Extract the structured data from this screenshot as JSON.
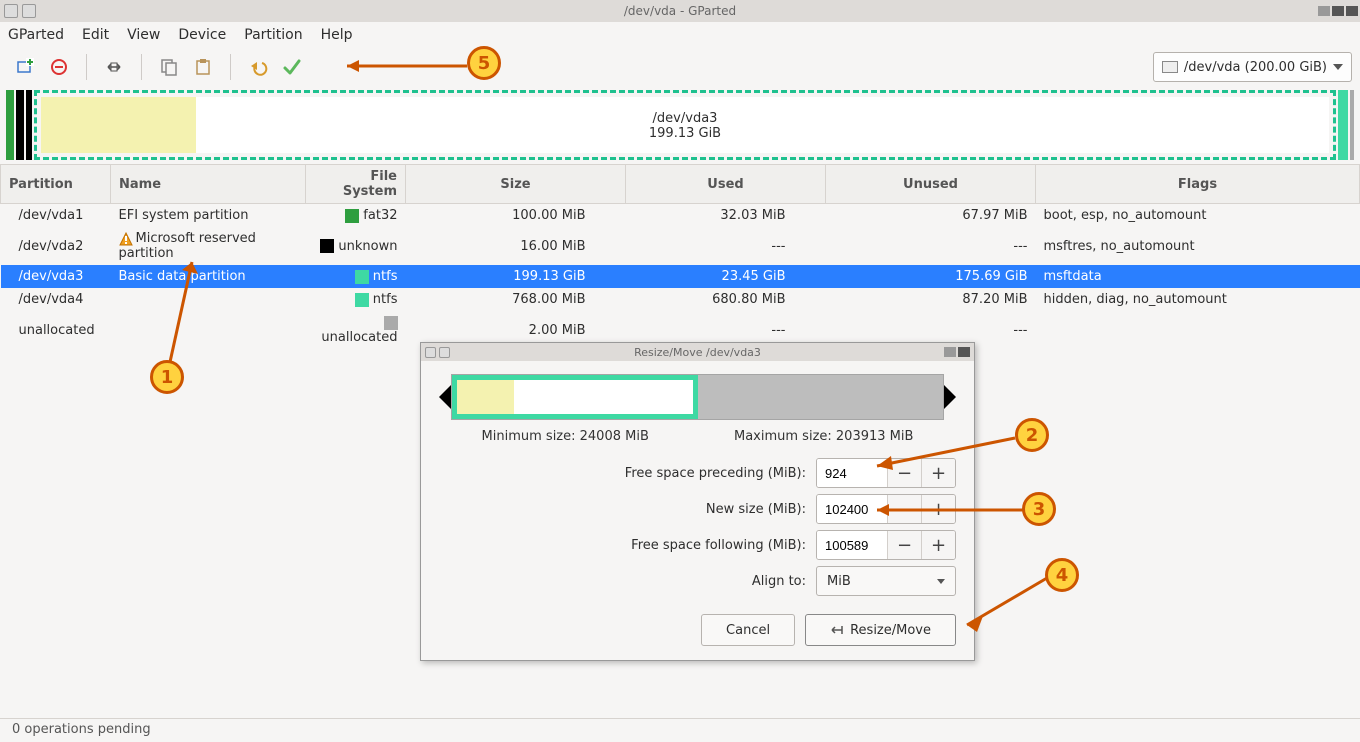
{
  "window": {
    "title": "/dev/vda - GParted"
  },
  "menu": {
    "gparted": "GParted",
    "edit": "Edit",
    "view": "View",
    "device": "Device",
    "partition": "Partition",
    "help": "Help"
  },
  "toolbar": {
    "device_label": "/dev/vda (200.00 GiB)"
  },
  "diskmap": {
    "selected_label": "/dev/vda3",
    "selected_size": "199.13 GiB"
  },
  "columns": {
    "partition": "Partition",
    "name": "Name",
    "fs": "File System",
    "size": "Size",
    "used": "Used",
    "unused": "Unused",
    "flags": "Flags"
  },
  "rows": [
    {
      "part": "/dev/vda1",
      "warn": false,
      "name": "EFI system partition",
      "fs": "fat32",
      "fscolor": "#2e9e3f",
      "size": "100.00 MiB",
      "used": "32.03 MiB",
      "unused": "67.97 MiB",
      "flags": "boot, esp, no_automount",
      "sel": false
    },
    {
      "part": "/dev/vda2",
      "warn": true,
      "name": "Microsoft reserved partition",
      "fs": "unknown",
      "fscolor": "#000",
      "size": "16.00 MiB",
      "used": "---",
      "unused": "---",
      "flags": "msftres, no_automount",
      "sel": false
    },
    {
      "part": "/dev/vda3",
      "warn": false,
      "name": "Basic data partition",
      "fs": "ntfs",
      "fscolor": "#3ed9a3",
      "size": "199.13 GiB",
      "used": "23.45 GiB",
      "unused": "175.69 GiB",
      "flags": "msftdata",
      "sel": true
    },
    {
      "part": "/dev/vda4",
      "warn": false,
      "name": "",
      "fs": "ntfs",
      "fscolor": "#3ed9a3",
      "size": "768.00 MiB",
      "used": "680.80 MiB",
      "unused": "87.20 MiB",
      "flags": "hidden, diag, no_automount",
      "sel": false
    },
    {
      "part": "unallocated",
      "warn": false,
      "name": "",
      "fs": "unallocated",
      "fscolor": "#aaa",
      "size": "2.00 MiB",
      "used": "---",
      "unused": "---",
      "flags": "",
      "sel": false
    }
  ],
  "dialog": {
    "title": "Resize/Move /dev/vda3",
    "min": "Minimum size: 24008 MiB",
    "max": "Maximum size: 203913 MiB",
    "preceding_label": "Free space preceding (MiB):",
    "preceding_value": "924",
    "newsize_label": "New size (MiB):",
    "newsize_value": "102400",
    "following_label": "Free space following (MiB):",
    "following_value": "100589",
    "align_label": "Align to:",
    "align_value": "MiB",
    "cancel": "Cancel",
    "resize": "Resize/Move"
  },
  "status": {
    "text": "0 operations pending"
  },
  "annotations": {
    "a1": "1",
    "a2": "2",
    "a3": "3",
    "a4": "4",
    "a5": "5"
  }
}
